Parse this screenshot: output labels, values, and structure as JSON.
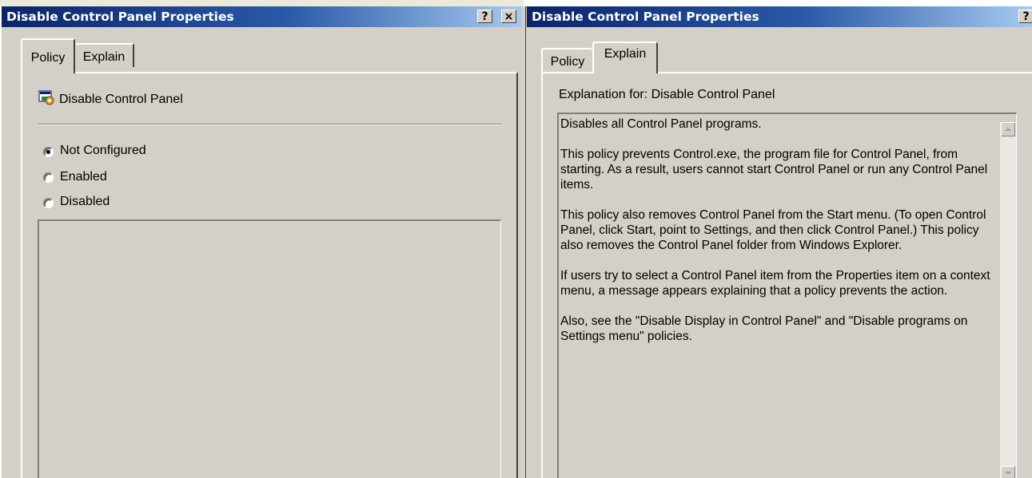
{
  "left_window": {
    "title": "Disable Control Panel Properties",
    "help_button": "?",
    "close_button": "×",
    "tabs": [
      "Policy",
      "Explain"
    ],
    "active_tab": "Policy",
    "policy_name": "Disable Control Panel",
    "options": [
      {
        "label": "Not Configured",
        "checked": true
      },
      {
        "label": "Enabled",
        "checked": false
      },
      {
        "label": "Disabled",
        "checked": false
      }
    ]
  },
  "right_window": {
    "title": "Disable Control Panel Properties",
    "help_button": "?",
    "close_button": "×",
    "tabs": [
      "Policy",
      "Explain"
    ],
    "active_tab": "Explain",
    "explanation_label": "Explanation for:  Disable Control Panel",
    "explanation_paragraphs": [
      "Disables all Control Panel programs.",
      "This policy prevents Control.exe, the program file for Control Panel, from starting. As a result, users cannot start Control Panel or run any Control Panel items.",
      "This policy also removes Control Panel from the Start menu. (To open Control Panel, click Start, point to Settings, and then click Control Panel.) This policy also removes the Control Panel folder from Windows Explorer.",
      "If users try to select a Control Panel item from the Properties item on a context menu, a message appears explaining that a policy prevents the action.",
      "Also, see the \"Disable Display in Control Panel\" and \"Disable programs on Settings menu\" policies."
    ]
  }
}
